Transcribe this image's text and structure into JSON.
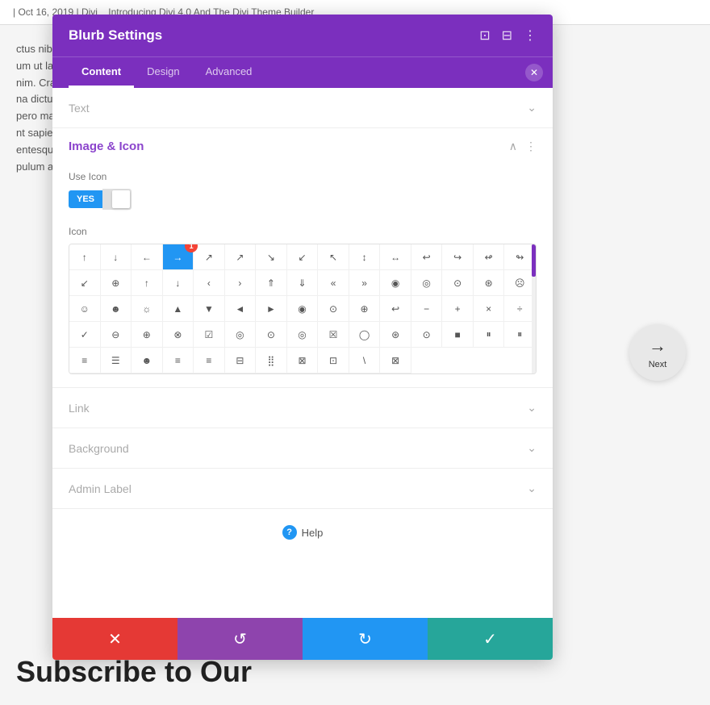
{
  "page": {
    "header_text": "| Oct 16, 2019 | Divi",
    "page_title_partial": "Introducing Divi 4.0 And The Divi Theme Builder",
    "background_text_lines": [
      "ctus nibh.",
      "um ut lacin",
      "nim. Cras",
      "na dictum",
      "pero males",
      "nt sapien",
      "entesque n",
      "pulum ante"
    ],
    "subscribe_text": "Subscribe to Our",
    "next_button": {
      "arrow": "→",
      "label": "Next"
    }
  },
  "modal": {
    "title": "Blurb Settings",
    "tabs": [
      {
        "label": "Content",
        "active": true
      },
      {
        "label": "Design",
        "active": false
      },
      {
        "label": "Advanced",
        "active": false
      }
    ],
    "header_icons": [
      "⊡",
      "⊟",
      "⋮"
    ],
    "close_icon": "✕",
    "sections": {
      "text": {
        "label": "Text",
        "expanded": false
      },
      "image_icon": {
        "label": "Image & Icon",
        "expanded": true,
        "use_icon": {
          "label": "Use Icon",
          "yes_label": "YES",
          "value": true
        },
        "icon": {
          "label": "Icon",
          "badge": "1",
          "selected_index": 3,
          "symbols": [
            "↑",
            "↓",
            "←",
            "→",
            "↗",
            "↗",
            "↘",
            "↙",
            "↖",
            "↕",
            "↔",
            "↩",
            "↪",
            "↫",
            "↬",
            "↙",
            "⊕",
            "↑",
            "↓",
            "‹",
            "›",
            "⇑",
            "⇓",
            "«",
            "»",
            "◉",
            "◎",
            "⊙",
            "⊛",
            "☹",
            "☺",
            "☻",
            "☼",
            "▲",
            "▼",
            "◄",
            "►",
            "◉",
            "⊙",
            "⊕",
            "↩",
            "−",
            "+",
            "×",
            "÷",
            "✓",
            "⊖",
            "⊕",
            "⊗",
            "☑",
            "◎",
            "⊙",
            "◎",
            "☒",
            "◯",
            "⊛",
            "⊙",
            "■",
            "⏸",
            "⏸",
            "≡",
            "☰",
            "☻",
            "≡",
            "≡",
            "⊟",
            "⣿",
            "⊠",
            "⊡",
            "\\",
            "⊠"
          ]
        }
      },
      "link": {
        "label": "Link",
        "expanded": false
      },
      "background": {
        "label": "Background",
        "expanded": false
      },
      "admin_label": {
        "label": "Admin Label",
        "expanded": false
      }
    },
    "help": {
      "icon": "?",
      "label": "Help"
    },
    "footer": {
      "cancel_icon": "✕",
      "undo_icon": "↺",
      "redo_icon": "↻",
      "save_icon": "✓"
    }
  }
}
